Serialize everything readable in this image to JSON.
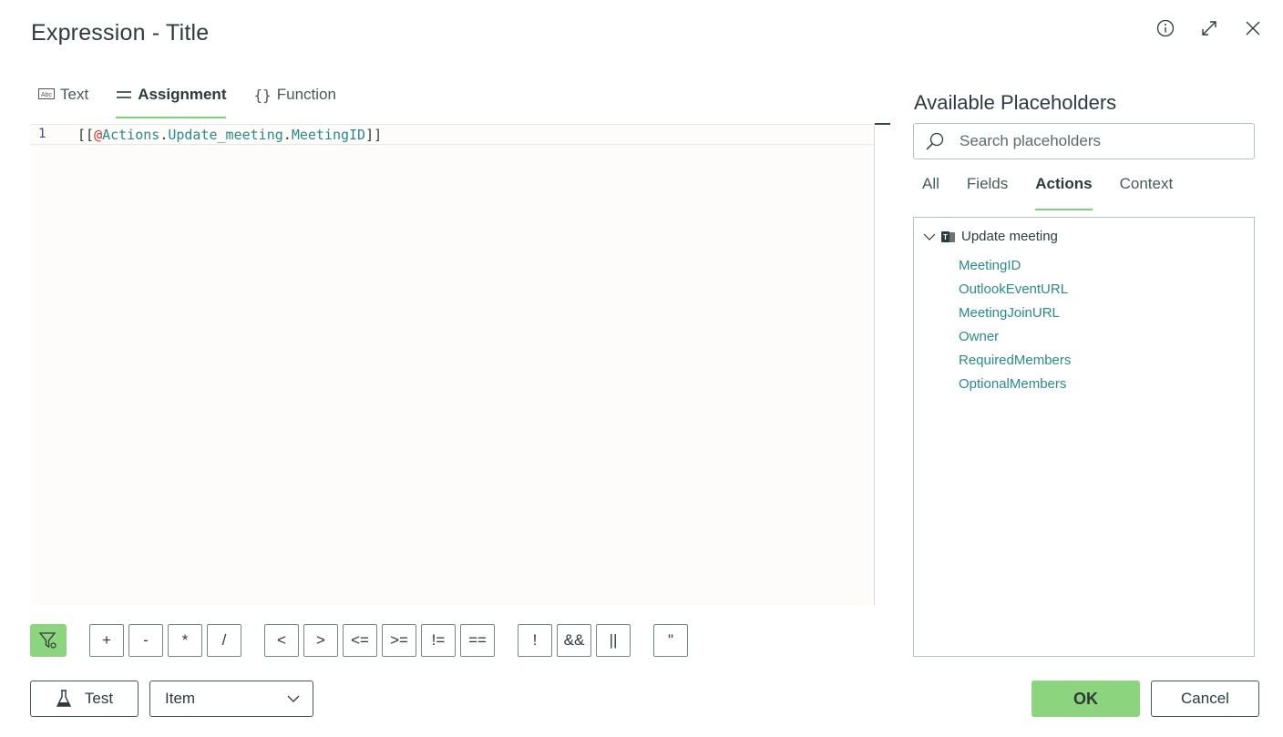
{
  "dialog": {
    "title": "Expression - Title"
  },
  "window_icons": [
    "info-icon",
    "expand-icon",
    "close-icon"
  ],
  "editor": {
    "tabs": [
      {
        "label": "Text",
        "icon": "abc-icon"
      },
      {
        "label": "Assignment",
        "icon": "equals-icon",
        "active": true
      },
      {
        "label": "Function",
        "icon": "braces-icon"
      }
    ],
    "line_number": "1",
    "code": {
      "open": "[[",
      "at": "@",
      "p1": "Actions",
      "dot1": ".",
      "p2": "Update_meeting",
      "dot2": ".",
      "p3": "MeetingID",
      "close": "]]"
    }
  },
  "operators": {
    "arith": [
      "+",
      "-",
      "*",
      "/"
    ],
    "compare": [
      "<",
      ">",
      "<=",
      ">=",
      "!=",
      "=="
    ],
    "logic": [
      "!",
      "&&",
      "||"
    ],
    "quote": [
      "\""
    ]
  },
  "footer": {
    "test_label": "Test",
    "item_select": "Item",
    "ok_label": "OK",
    "cancel_label": "Cancel"
  },
  "placeholders": {
    "title": "Available Placeholders",
    "search_placeholder": "Search placeholders",
    "tabs": [
      "All",
      "Fields",
      "Actions",
      "Context"
    ],
    "active_tab": "Actions",
    "group": "Update meeting",
    "items": [
      "MeetingID",
      "OutlookEventURL",
      "MeetingJoinURL",
      "Owner",
      "RequiredMembers",
      "OptionalMembers"
    ]
  },
  "colors": {
    "accent": "#8cd47e",
    "link": "#2a8a8a"
  }
}
